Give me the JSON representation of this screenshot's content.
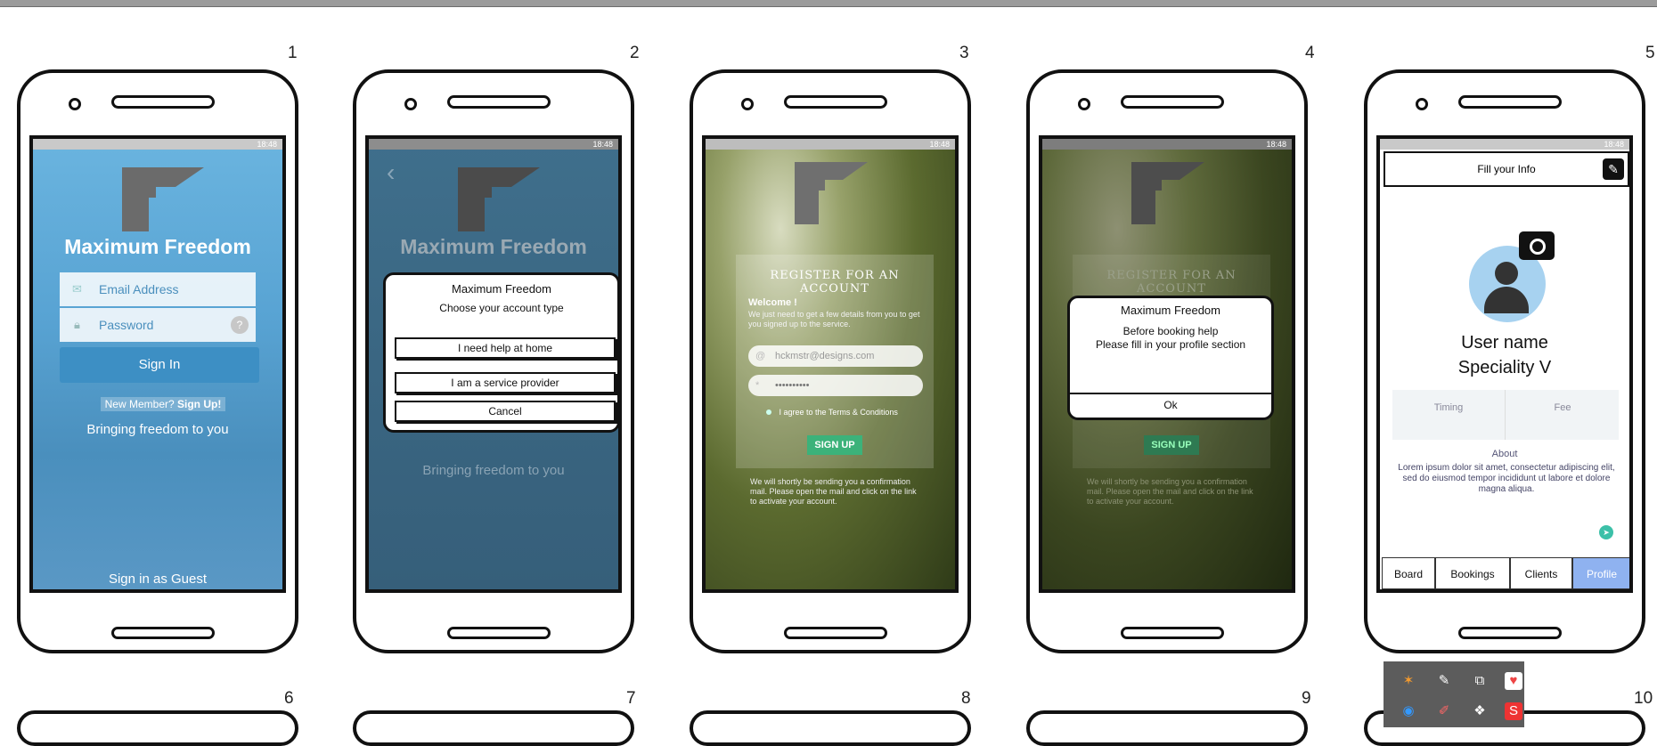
{
  "numbers": [
    "1",
    "2",
    "3",
    "4",
    "5",
    "6",
    "7",
    "8",
    "9",
    "10"
  ],
  "status_time": "18:48",
  "app_name": "Maximum Freedom",
  "s1": {
    "email_placeholder": "Email Address",
    "password_placeholder": "Password",
    "help_glyph": "?",
    "sign_in": "Sign In",
    "new_member": "New Member?",
    "sign_up": "Sign Up!",
    "tagline": "Bringing freedom to you",
    "guest": "Sign in as Guest"
  },
  "s2": {
    "back": "‹",
    "dialog_title": "Maximum Freedom",
    "dialog_sub": "Choose your account type",
    "opt_home": "I need help at home",
    "opt_provider": "I am a service provider",
    "cancel": "Cancel",
    "tagline": "Bringing freedom to you"
  },
  "s3": {
    "title": "REGISTER FOR AN ACCOUNT",
    "welcome": "Welcome !",
    "intro": "We just need to get a few details from you to get you signed up to the service.",
    "email_value": "hckmstr@designs.com",
    "password_value": "••••••••••",
    "agree": "I agree to the Terms & Conditions",
    "signup": "SIGN UP",
    "footer": "We will shortly be sending you a confirmation mail. Please open the mail and click on the link to activate your account."
  },
  "s4": {
    "title": "REGISTER FOR AN ACCOUNT",
    "dialog_title": "Maximum Freedom",
    "dialog_line1": "Before booking help",
    "dialog_line2": "Please fill in your profile section",
    "ok": "Ok",
    "signup": "SIGN UP",
    "footer": "We will shortly be sending you a confirmation mail. Please open the mail and click on the link to activate your account."
  },
  "s5": {
    "header": "Fill your Info",
    "user_name": "User name",
    "speciality": "Speciality V",
    "timing": "Timing",
    "fee": "Fee",
    "about": "About",
    "about_text": "Lorem ipsum dolor sit amet, consectetur adipiscing elit, sed do eiusmod tempor incididunt ut labore et dolore magna aliqua.",
    "tabs": [
      "Board",
      "Bookings",
      "Clients",
      "Profile"
    ]
  },
  "colors": {
    "accent_blue": "#3d8fc4",
    "signup_green": "#3cb27a",
    "active_tab": "#8fb2f0"
  },
  "tray_icons": [
    "app-icon-1",
    "app-icon-2",
    "app-icon-3",
    "app-icon-4",
    "app-icon-5",
    "app-icon-6",
    "app-icon-7",
    "app-icon-8"
  ]
}
